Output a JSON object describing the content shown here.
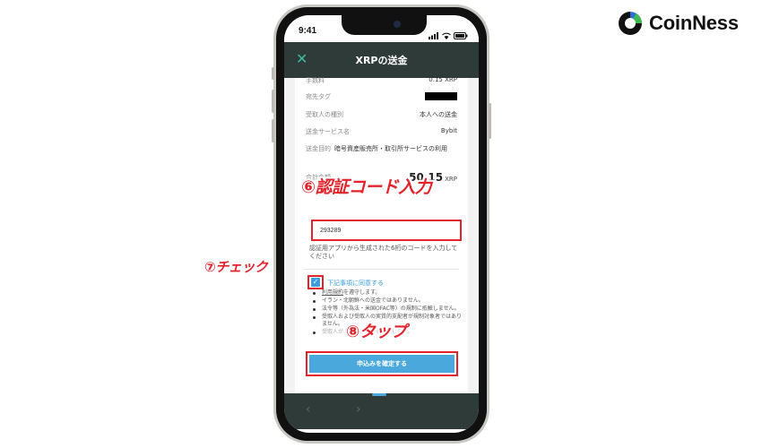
{
  "brand": {
    "name": "CoinNess",
    "colors": {
      "green": "#3fb94f",
      "blue": "#2b6fd6",
      "dark": "#111111"
    }
  },
  "status_bar": {
    "time": "9:41"
  },
  "header": {
    "title": "XRPの送金",
    "close_icon": "close-icon"
  },
  "details": [
    {
      "label": "手数料",
      "value": "0.15 XRP"
    },
    {
      "label": "宛先タグ",
      "value": ""
    },
    {
      "label": "受取人の種別",
      "value": "本人への送金"
    },
    {
      "label": "送金サービス名",
      "value": "Bybit"
    },
    {
      "label": "送金目的",
      "value": "暗号資産販売所・取引所サービスの利用"
    }
  ],
  "total": {
    "label": "合計金額",
    "amount": "50.15",
    "unit": "XRP"
  },
  "auth_code": {
    "value": "293289",
    "hint": "認証用アプリから生成された6桁のコードを入力してください"
  },
  "agreement": {
    "label": "下記事項に同意する",
    "items": [
      {
        "link": "利用規約",
        "text": "を遵守します。"
      },
      {
        "text": "イラン・北朝鮮への送金ではありません。"
      },
      {
        "text": "法令等（外為法・米国OFAC等）の規制に抵触しません。"
      },
      {
        "text": "受取人および受取人の実質的支配者が規制対象者ではありません。"
      },
      {
        "text": "受取人が…であることを確認します。"
      }
    ]
  },
  "submit": {
    "label": "申込みを確定する"
  },
  "annotations": {
    "step6": "⑥認証コード入力",
    "step7": "⑦チェック",
    "step8": "⑧タップ",
    "color": "#e3232b"
  },
  "accent_colors": {
    "nav": "#2e3b38",
    "teal": "#3fb8a8",
    "button": "#4aa8dc",
    "check": "#3a9ee0"
  }
}
